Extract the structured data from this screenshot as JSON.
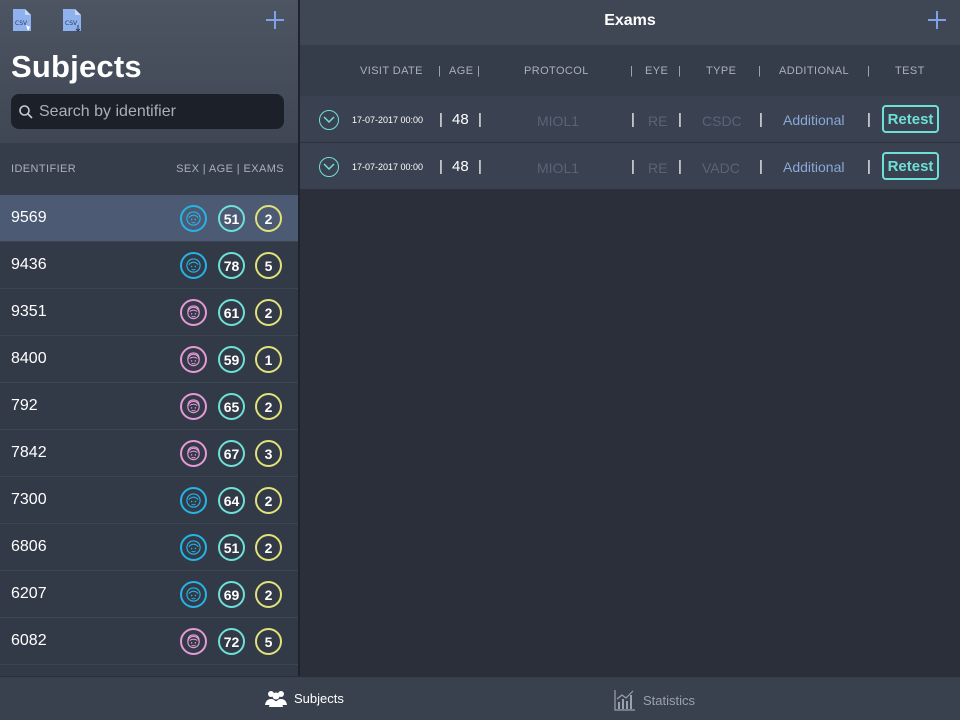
{
  "left_panel": {
    "title": "Subjects",
    "csv_icon_label": "CSV",
    "search": {
      "placeholder": "Search by identifier",
      "value": ""
    },
    "list_header": {
      "identifier": "IDENTIFIER",
      "sex_age_exams": "SEX | AGE | EXAMS"
    },
    "subjects": [
      {
        "id": "9569",
        "sex": "male",
        "age": "51",
        "exams": "2",
        "selected": true
      },
      {
        "id": "9436",
        "sex": "male",
        "age": "78",
        "exams": "5"
      },
      {
        "id": "9351",
        "sex": "female",
        "age": "61",
        "exams": "2"
      },
      {
        "id": "8400",
        "sex": "female",
        "age": "59",
        "exams": "1"
      },
      {
        "id": "792",
        "sex": "female",
        "age": "65",
        "exams": "2"
      },
      {
        "id": "7842",
        "sex": "female",
        "age": "67",
        "exams": "3"
      },
      {
        "id": "7300",
        "sex": "male",
        "age": "64",
        "exams": "2"
      },
      {
        "id": "6806",
        "sex": "male",
        "age": "51",
        "exams": "2"
      },
      {
        "id": "6207",
        "sex": "male",
        "age": "69",
        "exams": "2"
      },
      {
        "id": "6082",
        "sex": "female",
        "age": "72",
        "exams": "5"
      }
    ]
  },
  "right_panel": {
    "title": "Exams",
    "columns": {
      "visit_date": "VISIT DATE",
      "age": "AGE",
      "protocol": "PROTOCOL",
      "eye": "EYE",
      "type": "TYPE",
      "additional": "ADDITIONAL",
      "test": "TEST"
    },
    "exams": [
      {
        "date": "17-07-2017 00:00",
        "age": "48",
        "protocol": "MIOL1",
        "eye": "RE",
        "type": "CSDC",
        "additional": "Additional",
        "test": "Retest"
      },
      {
        "date": "17-07-2017 00:00",
        "age": "48",
        "protocol": "MIOL1",
        "eye": "RE",
        "type": "VADC",
        "additional": "Additional",
        "test": "Retest"
      }
    ]
  },
  "tabbar": {
    "subjects": "Subjects",
    "statistics": "Statistics"
  },
  "colors": {
    "male": "#26b3e6",
    "female": "#e59ad8",
    "age": "#6fe0d8",
    "exams": "#e2e27a",
    "accent": "#7da3e6"
  }
}
